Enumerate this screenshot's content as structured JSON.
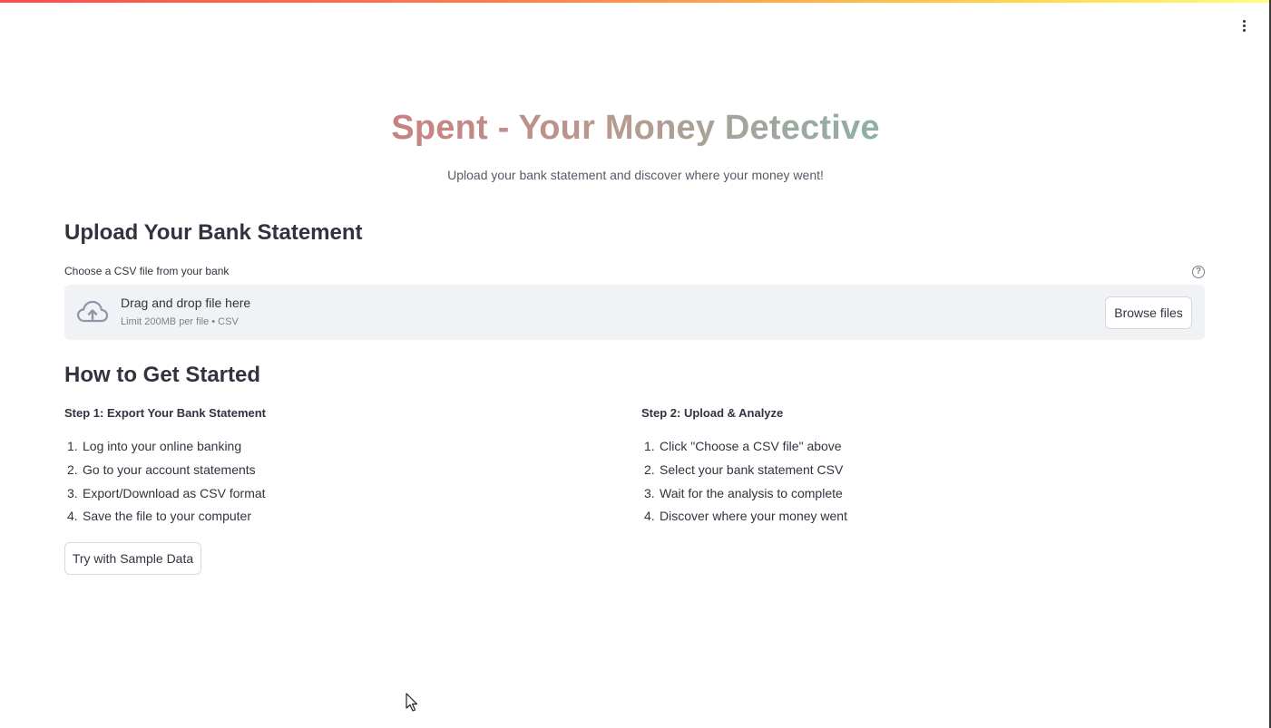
{
  "header": {
    "title": "Spent - Your Money Detective",
    "subtitle": "Upload your bank statement and discover where your money went!",
    "menu_icon": "kebab-menu-icon"
  },
  "upload": {
    "heading": "Upload Your Bank Statement",
    "label": "Choose a CSV file from your bank",
    "help_icon": "question-circle-icon",
    "drop_text": "Drag and drop file here",
    "limit_text": "Limit 200MB per file • CSV",
    "browse_label": "Browse files",
    "upload_icon": "cloud-upload-icon"
  },
  "guide": {
    "heading": "How to Get Started",
    "step1": {
      "title": "Step 1: Export Your Bank Statement",
      "items": [
        {
          "num": "1.",
          "text": "Log into your online banking"
        },
        {
          "num": "2.",
          "text": "Go to your account statements"
        },
        {
          "num": "3.",
          "text": "Export/Download as CSV format"
        },
        {
          "num": "4.",
          "text": "Save the file to your computer"
        }
      ]
    },
    "step2": {
      "title": "Step 2: Upload & Analyze",
      "items": [
        {
          "num": "1.",
          "text": "Click \"Choose a CSV file\" above"
        },
        {
          "num": "2.",
          "text": "Select your bank statement CSV"
        },
        {
          "num": "3.",
          "text": "Wait for the analysis to complete"
        },
        {
          "num": "4.",
          "text": "Discover where your money went"
        }
      ]
    },
    "sample_button": "Try with Sample Data"
  },
  "colors": {
    "title_gradient_start": "#c98080",
    "title_gradient_end": "#8fb0a6",
    "dropzone_bg": "#f0f2f6",
    "text": "#31333f"
  }
}
